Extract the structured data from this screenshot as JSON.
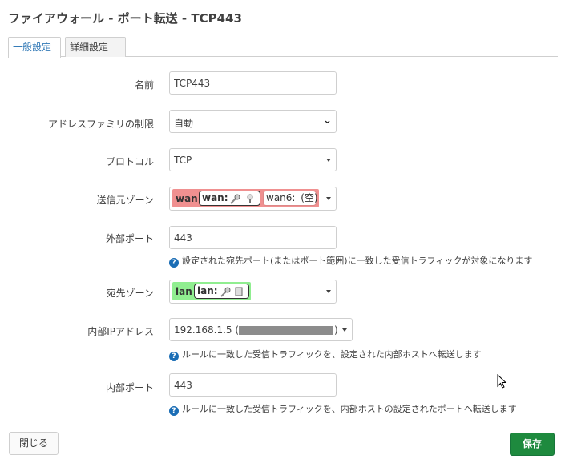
{
  "header": {
    "title": "ファイアウォール - ポート転送 - TCP443"
  },
  "tabs": [
    {
      "label": "一般設定"
    },
    {
      "label": "詳細設定"
    }
  ],
  "form": {
    "name": {
      "label": "名前",
      "value": "TCP443"
    },
    "family": {
      "label": "アドレスファミリの制限",
      "value": "自動"
    },
    "protocol": {
      "label": "プロトコル",
      "value": "TCP"
    },
    "src_zone": {
      "label": "送信元ゾーン",
      "zones": [
        {
          "name": "wan",
          "iface": "wan:",
          "color": "#f09090"
        },
        {
          "name": "",
          "iface": "wan6:",
          "extra": "(空)",
          "color": "#f09090"
        }
      ]
    },
    "src_dport": {
      "label": "外部ポート",
      "value": "443",
      "help": "設定された宛先ポート(またはポート範囲)に一致した受信トラフィックが対象になります"
    },
    "dest_zone": {
      "label": "宛先ゾーン",
      "zones": [
        {
          "name": "lan",
          "iface": "lan:",
          "color": "#90ee90"
        }
      ]
    },
    "dest_ip": {
      "label": "内部IPアドレス",
      "value": "192.168.1.5 (",
      "value_end": ")",
      "help": "ルールに一致した受信トラフィックを、設定された内部ホストへ転送します"
    },
    "dest_port": {
      "label": "内部ポート",
      "value": "443",
      "help": "ルールに一致した受信トラフィックを、内部ホストの設定されたポートへ転送します"
    }
  },
  "footer": {
    "close_label": "閉じる",
    "save_label": "保存"
  },
  "colors": {
    "accent": "#337ab7",
    "save": "#1e8a3e",
    "wan_zone": "#f09090",
    "lan_zone": "#90ee90"
  }
}
